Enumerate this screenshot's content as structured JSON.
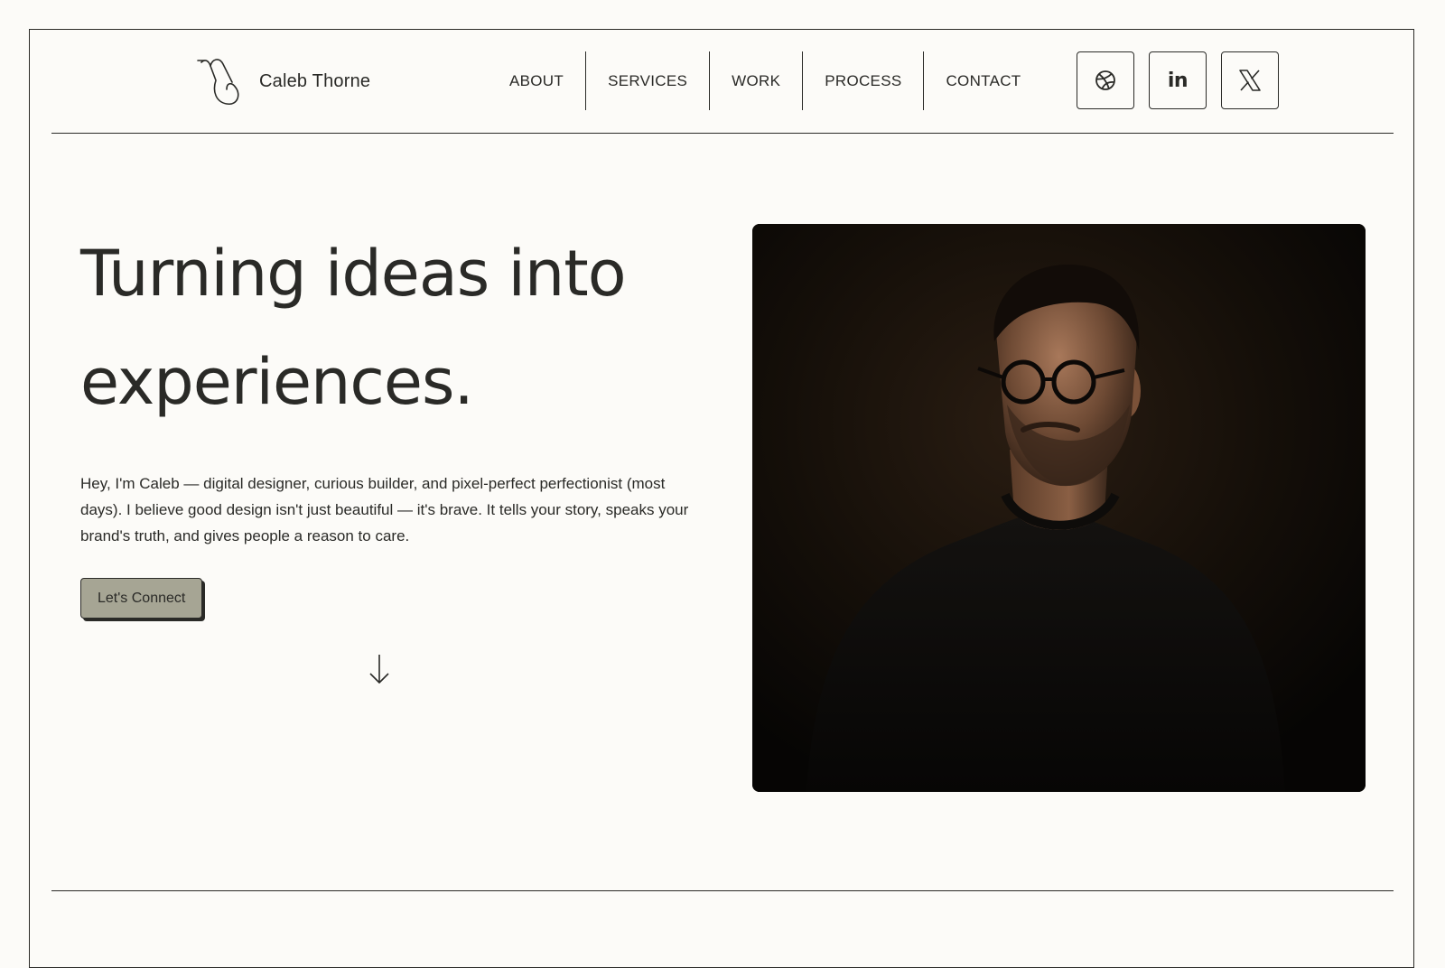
{
  "brand": {
    "name": "Caleb Thorne",
    "logo_icon": "paperclip-swirl-icon"
  },
  "nav": {
    "items": [
      {
        "label": "ABOUT"
      },
      {
        "label": "SERVICES"
      },
      {
        "label": "WORK"
      },
      {
        "label": "PROCESS"
      },
      {
        "label": "CONTACT"
      }
    ]
  },
  "socials": {
    "items": [
      {
        "icon": "dribbble-icon"
      },
      {
        "icon": "linkedin-icon",
        "glyph": "in"
      },
      {
        "icon": "x-twitter-icon"
      }
    ]
  },
  "hero": {
    "title_line1": "Turning ideas into",
    "title_line2": "experiences.",
    "body": "Hey, I'm Caleb — digital designer, curious builder, and pixel-perfect perfectionist (most days). I believe good design isn't just beautiful — it's brave. It tells your story, speaks your brand's truth, and gives people a reason to care.",
    "cta_label": "Let's Connect",
    "scroll_icon": "arrow-down-icon"
  },
  "portrait": {
    "icon": "portrait-photo"
  },
  "colors": {
    "background": "#fcfbf8",
    "ink": "#2a2a27",
    "cta_fill": "#a6a594",
    "photo_bg": "#0d0a07"
  }
}
